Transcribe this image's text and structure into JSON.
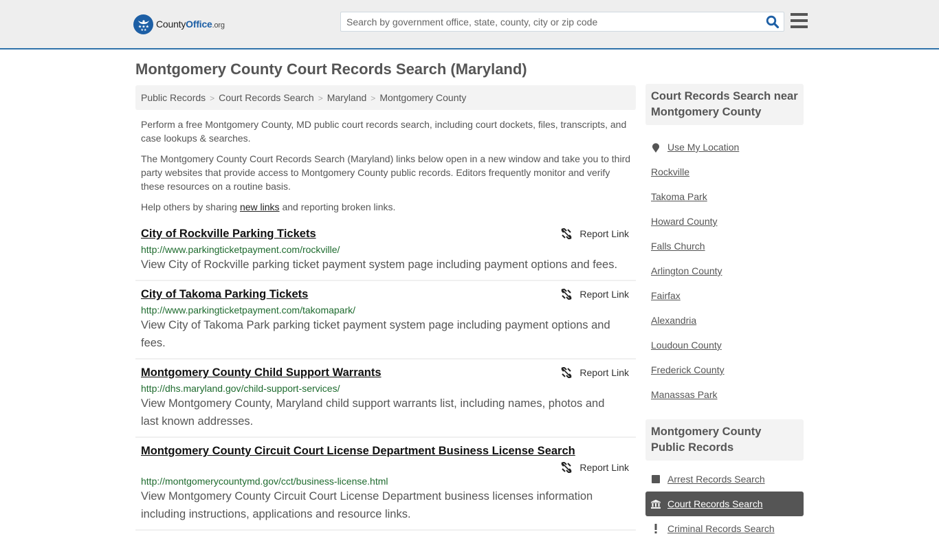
{
  "header": {
    "logo": {
      "name_a": "County",
      "name_b": "Office",
      "name_c": ".org"
    },
    "search": {
      "placeholder": "Search by government office, state, county, city or zip code",
      "value": ""
    },
    "colors": {
      "brand": "#1d5fa5",
      "accent_border": "#2f72aa"
    }
  },
  "page": {
    "title": "Montgomery County Court Records Search (Maryland)",
    "breadcrumb": [
      "Public Records",
      "Court Records Search",
      "Maryland",
      "Montgomery County"
    ],
    "intro": {
      "p1": "Perform a free Montgomery County, MD public court records search, including court dockets, files, transcripts, and case lookups & searches.",
      "p2": "The Montgomery County Court Records Search (Maryland) links below open in a new window and take you to third party websites that provide access to Montgomery County public records. Editors frequently monitor and verify these resources on a routine basis.",
      "p3_before": "Help others by sharing ",
      "p3_link": "new links",
      "p3_after": " and reporting broken links."
    }
  },
  "results": [
    {
      "title": "City of Rockville Parking Tickets",
      "url": "http://www.parkingticketpayment.com/rockville/",
      "description": "View City of Rockville parking ticket payment system page including payment options and fees.",
      "report_label": "Report Link"
    },
    {
      "title": "City of Takoma Parking Tickets",
      "url": "http://www.parkingticketpayment.com/takomapark/",
      "description": "View City of Takoma Park parking ticket payment system page including payment options and fees.",
      "report_label": "Report Link"
    },
    {
      "title": "Montgomery County Child Support Warrants",
      "url": "http://dhs.maryland.gov/child-support-services/",
      "description": "View Montgomery County, Maryland child support warrants list, including names, photos and last known addresses.",
      "report_label": "Report Link"
    },
    {
      "title": "Montgomery County Circuit Court License Department Business License Search",
      "url": "http://montgomerycountymd.gov/cct/business-license.html",
      "description": "View Montgomery County Circuit Court License Department business licenses information including instructions, applications and resource links.",
      "report_label": "Report Link"
    }
  ],
  "sidebar": {
    "nearby": {
      "heading": "Court Records Search near Montgomery County",
      "use_location": "Use My Location",
      "items": [
        "Rockville",
        "Takoma Park",
        "Howard County",
        "Falls Church",
        "Arlington County",
        "Fairfax",
        "Alexandria",
        "Loudoun County",
        "Frederick County",
        "Manassas Park"
      ]
    },
    "public_records": {
      "heading": "Montgomery County Public Records",
      "items": [
        {
          "label": "Arrest Records Search",
          "icon": "square-icon",
          "active": false
        },
        {
          "label": "Court Records Search",
          "icon": "courthouse-icon",
          "active": true
        },
        {
          "label": "Criminal Records Search",
          "icon": "exclamation-icon",
          "active": false
        }
      ]
    }
  }
}
